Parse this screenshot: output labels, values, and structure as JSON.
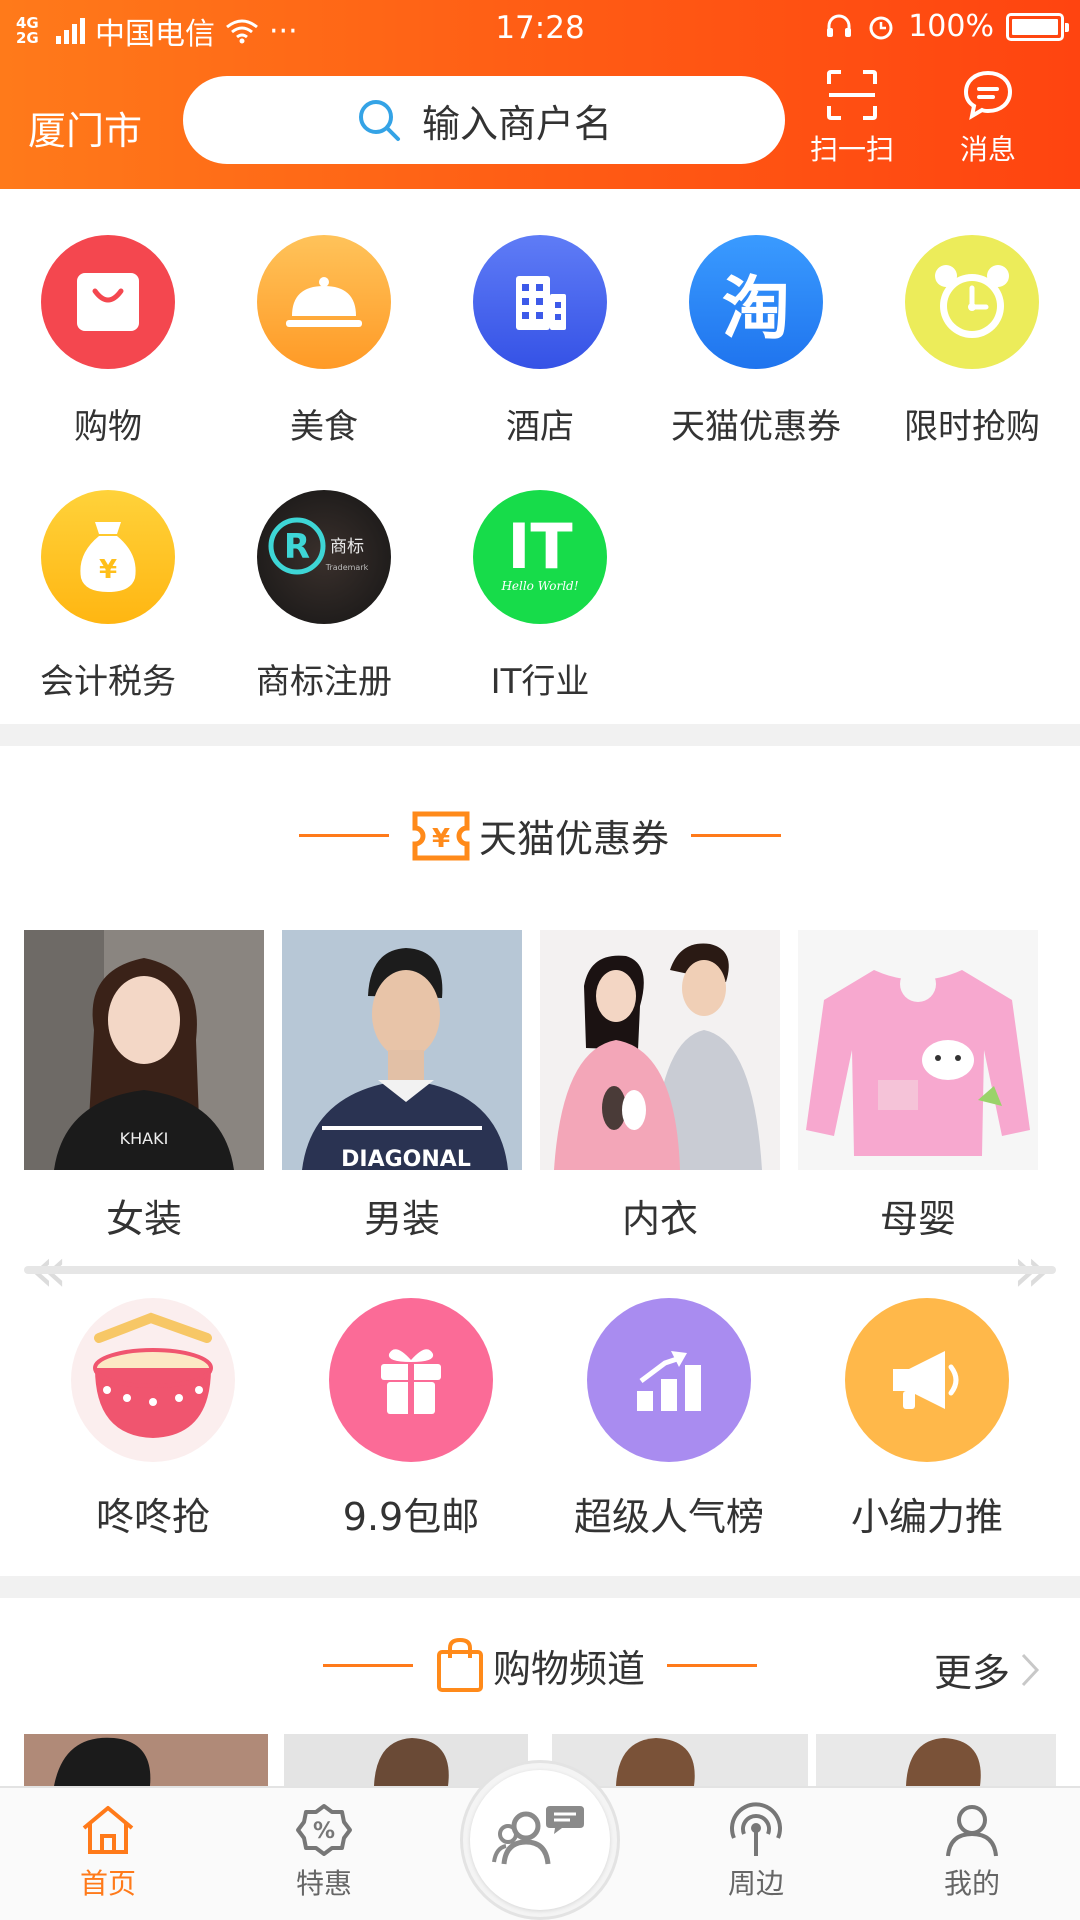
{
  "status_bar": {
    "network": "4G\n2G",
    "carrier": "中国电信",
    "dots": "···",
    "time": "17:28",
    "battery": "100%"
  },
  "header": {
    "city": "厦门市",
    "search_placeholder": "输入商户名",
    "scan_label": "扫一扫",
    "message_label": "消息"
  },
  "categories": [
    {
      "label": "购物",
      "icon": "shopping-bag-icon",
      "color": "#f4474f"
    },
    {
      "label": "美食",
      "icon": "food-cloche-icon",
      "color": "#ffa93a"
    },
    {
      "label": "酒店",
      "icon": "hotel-building-icon",
      "color": "#4f6ef2"
    },
    {
      "label": "天猫优惠券",
      "icon": "taobao-icon",
      "color": "#2f8df6"
    },
    {
      "label": "限时抢购",
      "icon": "alarm-clock-icon",
      "color": "#ecec5a"
    },
    {
      "label": "会计税务",
      "icon": "money-bag-icon",
      "color": "#ffc21a"
    },
    {
      "label": "商标注册",
      "icon": "trademark-icon",
      "color": "#222222",
      "badge_text": "商标",
      "badge_sub": "Trademark"
    },
    {
      "label": "IT行业",
      "icon": "it-icon",
      "color": "#17dc4a",
      "badge_text": "IT",
      "badge_sub": "Hello World!"
    }
  ],
  "coupon_section": {
    "title": "天猫优惠券",
    "coupon_symbol": "¥",
    "products": [
      {
        "label": "女装",
        "print": "KHAKI"
      },
      {
        "label": "男装",
        "print": "DIAGONAL"
      },
      {
        "label": "内衣",
        "print": ""
      },
      {
        "label": "母婴",
        "print": ""
      }
    ]
  },
  "features": [
    {
      "label": "咚咚抢",
      "icon": "drum-icon",
      "color": "#ffe2e2"
    },
    {
      "label": "9.9包邮",
      "icon": "gift-icon",
      "color": "#fb6b97"
    },
    {
      "label": "超级人气榜",
      "icon": "chart-up-icon",
      "color": "#a98cf0"
    },
    {
      "label": "小编力推",
      "icon": "megaphone-icon",
      "color": "#ffb84a"
    }
  ],
  "shopping_section": {
    "title": "购物频道",
    "more_label": "更多"
  },
  "tabbar": {
    "tabs": [
      {
        "label": "首页",
        "icon": "home-icon"
      },
      {
        "label": "特惠",
        "icon": "discount-icon"
      },
      {
        "label": "周边",
        "icon": "nearby-icon"
      },
      {
        "label": "我的",
        "icon": "profile-icon"
      }
    ],
    "active_color": "#ff7a1a"
  }
}
